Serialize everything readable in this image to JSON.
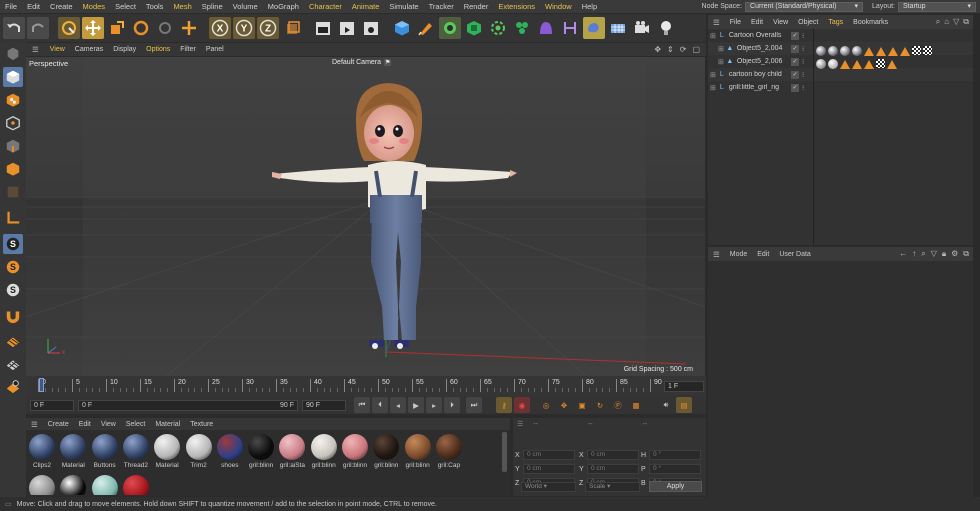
{
  "menu": [
    "File",
    "Edit",
    "Create",
    "Modes",
    "Select",
    "Tools",
    "Mesh",
    "Spline",
    "Volume",
    "MoGraph",
    "Character",
    "Animate",
    "Simulate",
    "Tracker",
    "Render",
    "Extensions",
    "Window",
    "Help"
  ],
  "menu_highlighted": [
    "Modes",
    "Mesh",
    "Character",
    "Animate",
    "Extensions",
    "Window"
  ],
  "node_space_label": "Node Space:",
  "node_space_value": "Current (Standard/Physical)",
  "layout_label": "Layout:",
  "layout_value": "Startup",
  "viewport_menu": [
    "View",
    "Cameras",
    "Display",
    "Options",
    "Filter",
    "Panel"
  ],
  "viewport_menu_highlighted": [
    "View",
    "Options"
  ],
  "viewport": {
    "name": "Perspective",
    "camera": "Default Camera",
    "grid_spacing": "Grid Spacing : 500 cm"
  },
  "object_manager": {
    "menu": [
      "File",
      "Edit",
      "View",
      "Object",
      "Tags",
      "Bookmarks"
    ],
    "menu_highlighted": [
      "Tags"
    ],
    "objects": [
      {
        "name": "Cartoon Overalls",
        "indent": 0
      },
      {
        "name": "Object5_2,004",
        "indent": 1
      },
      {
        "name": "Object5_2,006",
        "indent": 1
      },
      {
        "name": "cartoon boy child",
        "indent": 0
      },
      {
        "name": "grill:little_girl_rig",
        "indent": 0
      }
    ]
  },
  "attributes": {
    "menu": [
      "Mode",
      "Edit",
      "User Data"
    ]
  },
  "timeline": {
    "ticks": [
      "0",
      "5",
      "10",
      "15",
      "20",
      "25",
      "30",
      "35",
      "40",
      "45",
      "50",
      "55",
      "60",
      "65",
      "70",
      "75",
      "80",
      "85",
      "90"
    ],
    "current_frame": "1 F",
    "start_field": "0 F",
    "range_start": "0 F",
    "range_end": "90 F",
    "end_field": "90 F"
  },
  "material_manager": {
    "menu": [
      "Create",
      "Edit",
      "View",
      "Select",
      "Material",
      "Texture"
    ],
    "materials": [
      {
        "label": "Clips2",
        "color": "#2e3f63",
        "hl": "#8ea3cc"
      },
      {
        "label": "Material",
        "color": "#2e3f63",
        "hl": "#8ea3cc"
      },
      {
        "label": "Buttons",
        "color": "#2e3f63",
        "hl": "#8ea3cc"
      },
      {
        "label": "Thread2",
        "color": "#2e3f63",
        "hl": "#8ea3cc"
      },
      {
        "label": "Material",
        "color": "#b5b5b5",
        "hl": "#f2f2f2"
      },
      {
        "label": "Trim2",
        "color": "#b5b5b5",
        "hl": "#f2f2f2"
      },
      {
        "label": "shoes",
        "color": "#2f3f8a",
        "hl": "#9c3b3b"
      },
      {
        "label": "gril:blinn",
        "color": "#0b0b0b",
        "hl": "#4a4a4a"
      },
      {
        "label": "gril:aiSta",
        "color": "#c87b84",
        "hl": "#f0c2c7"
      },
      {
        "label": "gril:blinn",
        "color": "#c6c3bc",
        "hl": "#f4f2ec"
      },
      {
        "label": "gril:blinn",
        "color": "#c97377",
        "hl": "#f0b3b6"
      },
      {
        "label": "gril:blinn",
        "color": "#1e1410",
        "hl": "#5a4438"
      },
      {
        "label": "gril:blinn",
        "color": "#7a4a2c",
        "hl": "#c58a5a"
      },
      {
        "label": "gril:Cap",
        "color": "#4a2a1a",
        "hl": "#9a6648"
      }
    ],
    "materials_row2": [
      {
        "color": "#8a8a8a",
        "hl": "#d8d8d8"
      },
      {
        "color": "#0a0a0a",
        "hl": "#ffffff"
      },
      {
        "color": "#7fb7ad",
        "hl": "#d6efe9"
      },
      {
        "color": "#a3151b",
        "hl": "#e04a50"
      }
    ]
  },
  "coordinates": {
    "rows": [
      {
        "a": "X",
        "av": "0 cm",
        "b": "X",
        "bv": "0 cm",
        "c": "H",
        "cv": "0 °"
      },
      {
        "a": "Y",
        "av": "0 cm",
        "b": "Y",
        "bv": "0 cm",
        "c": "P",
        "cv": "0 °"
      },
      {
        "a": "Z",
        "av": "0 cm",
        "b": "Z",
        "bv": "0 cm",
        "c": "B",
        "cv": "0 °"
      }
    ],
    "mode": "World",
    "scale_mode": "Scale",
    "apply": "Apply"
  },
  "status_text": "Move: Click and drag to move elements. Hold down SHIFT to quantize movement / add to the selection in point mode, CTRL to remove."
}
